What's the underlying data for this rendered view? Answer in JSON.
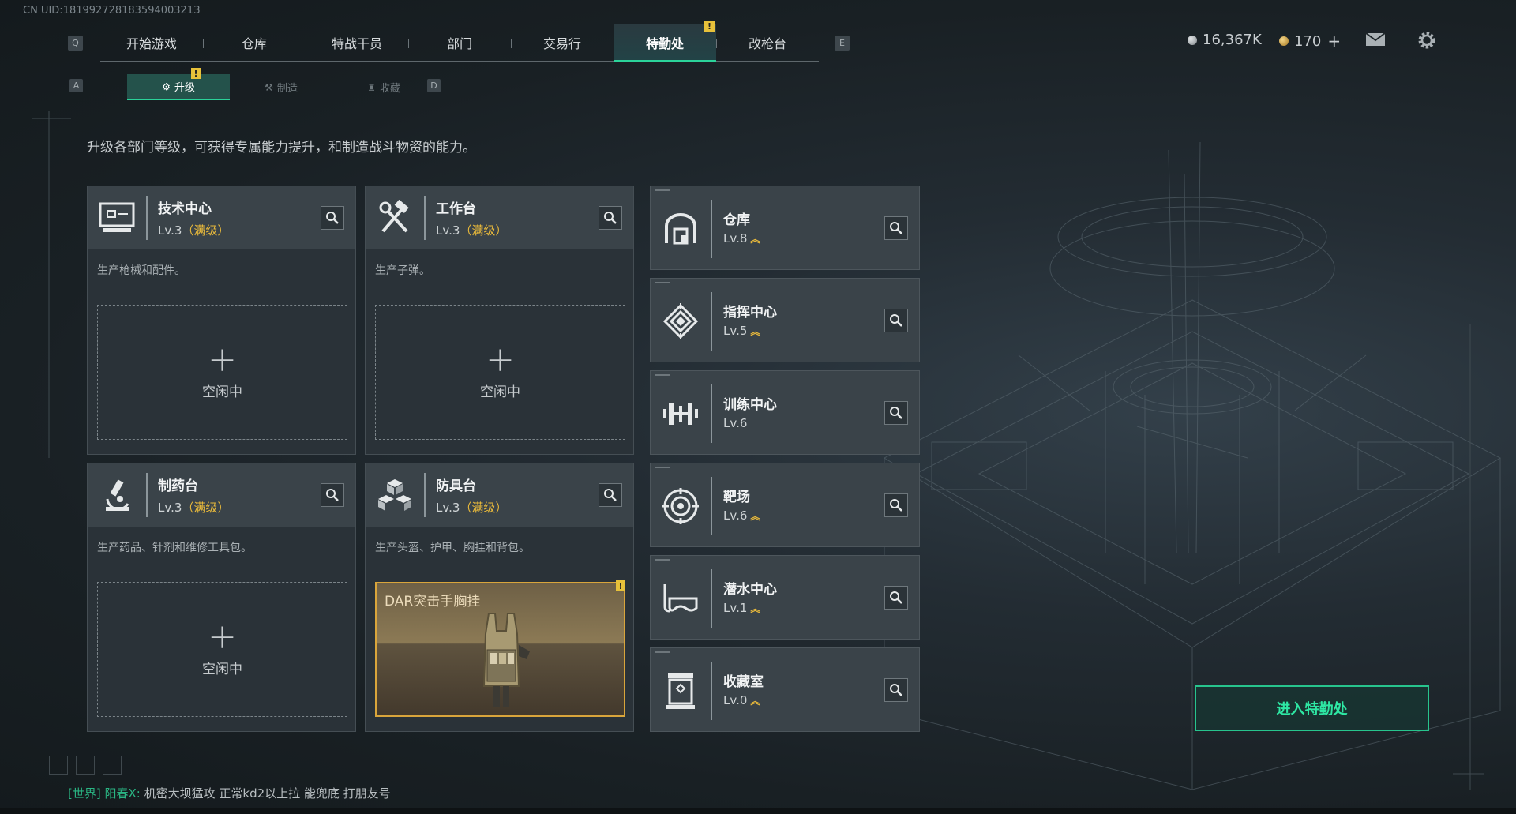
{
  "uid": "CN UID:18199272818359400321З",
  "top_nav": {
    "key_left": "Q",
    "key_right": "E",
    "tabs": [
      "开始游戏",
      "仓库",
      "特战干员",
      "部门",
      "交易行",
      "特勤处",
      "改枪台"
    ],
    "active_index": 5,
    "alert": "!"
  },
  "currency": {
    "silver": "16,367K",
    "gold": "170",
    "gold_plus": "+"
  },
  "sub_nav": {
    "key_left": "A",
    "key_right": "D",
    "tabs": [
      "升级",
      "制造",
      "收藏"
    ],
    "active_index": 0,
    "alert": "!"
  },
  "description": "升级各部门等级，可获得专属能力提升，和制造战斗物资的能力。",
  "big_cards": [
    {
      "icon": "computer-icon",
      "name": "技术中心",
      "level": "Lv.3",
      "max": "（满级）",
      "desc": "生产枪械和配件。",
      "slot_plus": "+",
      "slot_text": "空闲中"
    },
    {
      "icon": "hammer-wrench-icon",
      "name": "工作台",
      "level": "Lv.3",
      "max": "（满级）",
      "desc": "生产子弹。",
      "slot_plus": "+",
      "slot_text": "空闲中"
    },
    {
      "icon": "microscope-icon",
      "name": "制药台",
      "level": "Lv.3",
      "max": "（满级）",
      "desc": "生产药品、针剂和维修工具包。",
      "slot_plus": "+",
      "slot_text": "空闲中"
    },
    {
      "icon": "armor-blocks-icon",
      "name": "防具台",
      "level": "Lv.3",
      "max": "（满级）",
      "desc": "生产头盔、护甲、胸挂和背包。",
      "item_name": "DAR突击手胸挂",
      "item_alert": "!"
    }
  ],
  "small_cards": [
    {
      "icon": "warehouse-icon",
      "name": "仓库",
      "level": "Lv.8",
      "upgradable": true
    },
    {
      "icon": "command-diamond-icon",
      "name": "指挥中心",
      "level": "Lv.5",
      "upgradable": true
    },
    {
      "icon": "dumbbell-icon",
      "name": "训练中心",
      "level": "Lv.6",
      "upgradable": false
    },
    {
      "icon": "target-icon",
      "name": "靶场",
      "level": "Lv.6",
      "upgradable": true
    },
    {
      "icon": "diving-mask-icon",
      "name": "潜水中心",
      "level": "Lv.1",
      "upgradable": true
    },
    {
      "icon": "collection-box-icon",
      "name": "收藏室",
      "level": "Lv.0",
      "upgradable": true
    }
  ],
  "enter_button": "进入特勤处",
  "chat": {
    "channel": "[世界]",
    "user": "阳春X:",
    "message": "机密大坝猛攻 正常kd2以上拉  能兜底 打朋友号"
  },
  "colors": {
    "accent": "#2bd39a",
    "gold": "#e8b93b",
    "panel": "#3a4349"
  }
}
